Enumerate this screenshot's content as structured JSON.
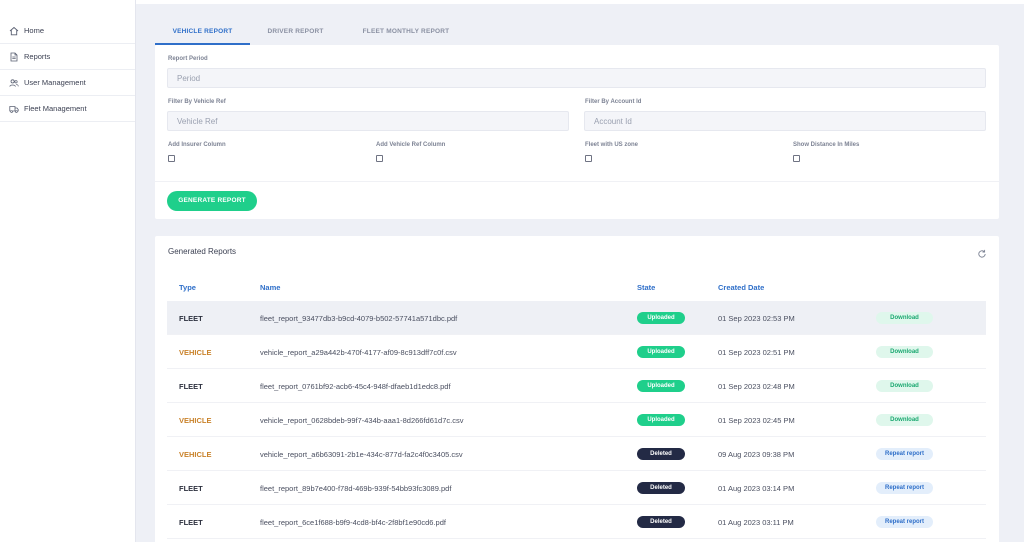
{
  "sidebar": {
    "items": [
      {
        "label": "Home",
        "icon": "home-icon"
      },
      {
        "label": "Reports",
        "icon": "document-icon"
      },
      {
        "label": "User Management",
        "icon": "users-icon"
      },
      {
        "label": "Fleet Management",
        "icon": "truck-icon"
      }
    ]
  },
  "tabs": [
    {
      "label": "VEHICLE REPORT",
      "active": true
    },
    {
      "label": "DRIVER REPORT",
      "active": false
    },
    {
      "label": "FLEET MONTHLY REPORT",
      "active": false
    }
  ],
  "form": {
    "report_period_label": "Report Period",
    "report_period_placeholder": "Period",
    "vehicle_ref_label": "Filter By Vehicle Ref",
    "vehicle_ref_placeholder": "Vehicle Ref",
    "account_id_label": "Filter By Account Id",
    "account_id_placeholder": "Account Id",
    "checkboxes": [
      {
        "label": "Add Insurer Column",
        "checked": false
      },
      {
        "label": "Add Vehicle Ref Column",
        "checked": false
      },
      {
        "label": "Fleet with US zone",
        "checked": false
      },
      {
        "label": "Show Distance In Miles",
        "checked": false
      }
    ],
    "generate_label": "GENERATE REPORT"
  },
  "reports": {
    "title": "Generated Reports",
    "columns": {
      "type": "Type",
      "name": "Name",
      "state": "State",
      "created": "Created Date"
    },
    "rows": [
      {
        "type": "FLEET",
        "name": "fleet_report_93477db3-b9cd-4079-b502-57741a571dbc.pdf",
        "state": "Uploaded",
        "created": "01 Sep 2023 02:53 PM",
        "action": "Download"
      },
      {
        "type": "VEHICLE",
        "name": "vehicle_report_a29a442b-470f-4177-af09-8c913dff7c0f.csv",
        "state": "Uploaded",
        "created": "01 Sep 2023 02:51 PM",
        "action": "Download"
      },
      {
        "type": "FLEET",
        "name": "fleet_report_0761bf92-acb6-45c4-948f-dfaeb1d1edc8.pdf",
        "state": "Uploaded",
        "created": "01 Sep 2023 02:48 PM",
        "action": "Download"
      },
      {
        "type": "VEHICLE",
        "name": "vehicle_report_0628bdeb-99f7-434b-aaa1-8d266fd61d7c.csv",
        "state": "Uploaded",
        "created": "01 Sep 2023 02:45 PM",
        "action": "Download"
      },
      {
        "type": "VEHICLE",
        "name": "vehicle_report_a6b63091-2b1e-434c-877d-fa2c4f0c3405.csv",
        "state": "Deleted",
        "created": "09 Aug 2023 09:38 PM",
        "action": "Repeat report"
      },
      {
        "type": "FLEET",
        "name": "fleet_report_89b7e400-f78d-469b-939f-54bb93fc3089.pdf",
        "state": "Deleted",
        "created": "01 Aug 2023 03:14 PM",
        "action": "Repeat report"
      },
      {
        "type": "FLEET",
        "name": "fleet_report_6ce1f688-b9f9-4cd8-bf4c-2f8bf1e90cd6.pdf",
        "state": "Deleted",
        "created": "01 Aug 2023 03:11 PM",
        "action": "Repeat report"
      }
    ]
  },
  "colors": {
    "accent": "#2f6fc9",
    "success": "#1fcf8b",
    "deleted": "#232a45",
    "vehicle_type": "#c9822a"
  }
}
